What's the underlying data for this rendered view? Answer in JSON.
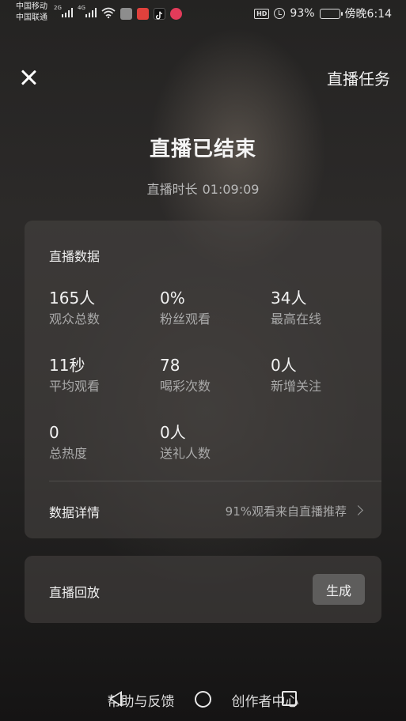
{
  "status_bar": {
    "carrier_1": "中国移动",
    "carrier_2": "中国联通",
    "net_1": "2G",
    "net_2": "4G",
    "battery_percent": "93%",
    "battery_level": 0.93,
    "time": "傍晚6:14",
    "hd_badge": "HD",
    "icons": [
      "signal-icon",
      "wifi-icon",
      "notification-app-icon",
      "tiktok-icon",
      "app-icon",
      "alarm-icon",
      "battery-icon"
    ]
  },
  "header": {
    "close_icon": "close-icon",
    "tasks_label": "直播任务"
  },
  "summary": {
    "title": "直播已结束",
    "duration_label": "直播时长",
    "duration_value": "01:09:09"
  },
  "stats": {
    "title": "直播数据",
    "items": [
      {
        "value": "165人",
        "label": "观众总数"
      },
      {
        "value": "0%",
        "label": "粉丝观看"
      },
      {
        "value": "34人",
        "label": "最高在线"
      },
      {
        "value": "11秒",
        "label": "平均观看"
      },
      {
        "value": "78",
        "label": "喝彩次数"
      },
      {
        "value": "0人",
        "label": "新增关注"
      },
      {
        "value": "0",
        "label": "总热度"
      },
      {
        "value": "0人",
        "label": "送礼人数"
      }
    ],
    "details_label": "数据详情",
    "details_note": "91%观看来自直播推荐"
  },
  "replay": {
    "label": "直播回放",
    "button_label": "生成"
  },
  "footer": {
    "help_label": "帮助与反馈",
    "creator_label": "创作者中心"
  },
  "colors": {
    "background": "#1c1b1b",
    "card": "#484644",
    "button": "#5e5d5c"
  }
}
